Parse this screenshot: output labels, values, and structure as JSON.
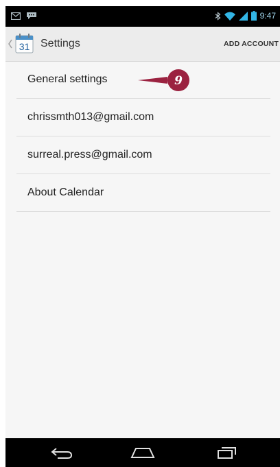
{
  "status_bar": {
    "time": "9:47",
    "icons": [
      "email-notification-icon",
      "chat-notification-icon",
      "bluetooth-icon",
      "wifi-icon",
      "signal-icon",
      "battery-icon"
    ]
  },
  "action_bar": {
    "title": "Settings",
    "app_icon_day": "31",
    "add_account_label": "ADD ACCOUNT"
  },
  "settings_items": [
    {
      "label": "General settings"
    },
    {
      "label": "chrissmth013@gmail.com"
    },
    {
      "label": "surreal.press@gmail.com"
    },
    {
      "label": "About Calendar"
    }
  ],
  "callout": {
    "number": "9",
    "color": "#9b2240"
  },
  "nav_bar": {
    "buttons": [
      "back-icon",
      "home-icon",
      "recent-apps-icon"
    ]
  },
  "colors": {
    "status_bar": "#000000",
    "action_bar": "#ececec",
    "content": "#f6f6f6",
    "accent_blue": "#33b5e5"
  }
}
